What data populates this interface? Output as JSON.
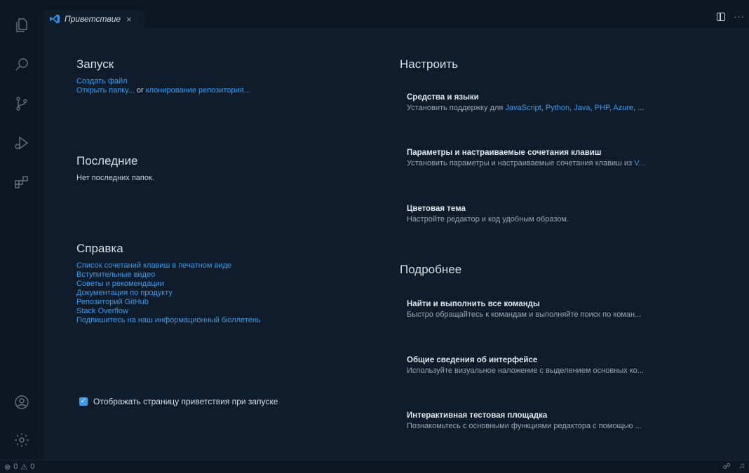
{
  "tab": {
    "title": "Приветствие",
    "close": "×"
  },
  "toolbar": {
    "more": "···"
  },
  "start": {
    "title": "Запуск",
    "new_file": "Создать файл",
    "open_folder": "Открыть папку...",
    "or": "or",
    "clone_repo": "клонирование репозитория..."
  },
  "recent": {
    "title": "Последние",
    "empty": "Нет последних папок."
  },
  "help": {
    "title": "Справка",
    "links": [
      "Список сочетаний клавиш в печатном виде",
      "Вступительные видео",
      "Советы и рекомендации",
      "Документация по продукту",
      "Репозиторий GitHub",
      "Stack Overflow",
      "Подпишитесь на наш информационный бюллетень"
    ]
  },
  "show_welcome": {
    "label": "Отображать страницу приветствия при запуске",
    "checked": true
  },
  "customize": {
    "title": "Настроить",
    "tools": {
      "title": "Средства и языки",
      "desc_prefix": "Установить поддержку для",
      "langs": [
        "JavaScript",
        "Python",
        "Java",
        "PHP",
        "Azure"
      ],
      "desc_suffix": ", ..."
    },
    "settings": {
      "title": "Параметры и настраиваемые сочетания клавиш",
      "desc": "Установить параметры и настраиваемые сочетания клавиш из",
      "link": "V..."
    },
    "theme": {
      "title": "Цветовая тема",
      "desc": "Настройте редактор и код удобным образом."
    }
  },
  "learn": {
    "title": "Подробнее",
    "commands": {
      "title": "Найти и выполнить все команды",
      "desc": "Быстро обращайтесь к командам и выполняйте поиск по коман..."
    },
    "overview": {
      "title": "Общие сведения об интерфейсе",
      "desc": "Используйте визуальное наложение с выделением основных ко..."
    },
    "playground": {
      "title": "Интерактивная тестовая площадка",
      "desc": "Познакомьтесь с основными функциями редактора с помощью ..."
    }
  },
  "status": {
    "errors": "0",
    "warnings": "0"
  },
  "colors": {
    "accent": "#3d9be9",
    "background": "#0f1c2b",
    "sidebar": "#0c1723"
  }
}
